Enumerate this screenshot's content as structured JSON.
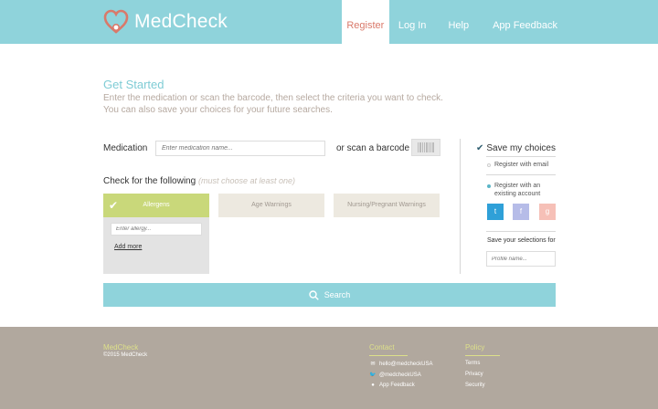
{
  "header": {
    "brand": "MedCheck",
    "nav": [
      "Register",
      "Log In",
      "Help",
      "App Feedback"
    ]
  },
  "intro": {
    "title": "Get Started",
    "line1": "Enter the medication or scan the barcode, then select the criteria you want to check.",
    "line2": "You can also save your choices for your future searches."
  },
  "medication": {
    "label": "Medication",
    "placeholder": "Enter medication name...",
    "scan_label": "or scan a barcode"
  },
  "criteria": {
    "title": "Check for the following",
    "hint": "(must choose at least one)",
    "options": [
      "Allergens",
      "Age Warnings",
      "Nursing/Pregnant Warnings"
    ],
    "allergy_placeholder": "Enter allergy...",
    "add_more": "Add more"
  },
  "save": {
    "title": "Save my choices",
    "option1": "Register with email",
    "option2_line1": "Register with an",
    "option2_line2": "existing account",
    "social": [
      "t",
      "f",
      "g"
    ],
    "selections_label": "Save your selections for",
    "profile_placeholder": "Profile name..."
  },
  "search": {
    "label": "Search"
  },
  "footer": {
    "brand": "MedCheck",
    "copyright": "©2015 MedCheck",
    "contact_head": "Contact",
    "contact": [
      "hello@medcheckUSA",
      "@medcheckUSA",
      "App Feedback"
    ],
    "policy_head": "Policy",
    "policy": [
      "Terms",
      "Privacy",
      "Security"
    ]
  },
  "colors": {
    "accent": "#8fd3db",
    "brand_coral": "#d9796a",
    "selected": "#c9d87a",
    "footer": "#b1a89e"
  }
}
